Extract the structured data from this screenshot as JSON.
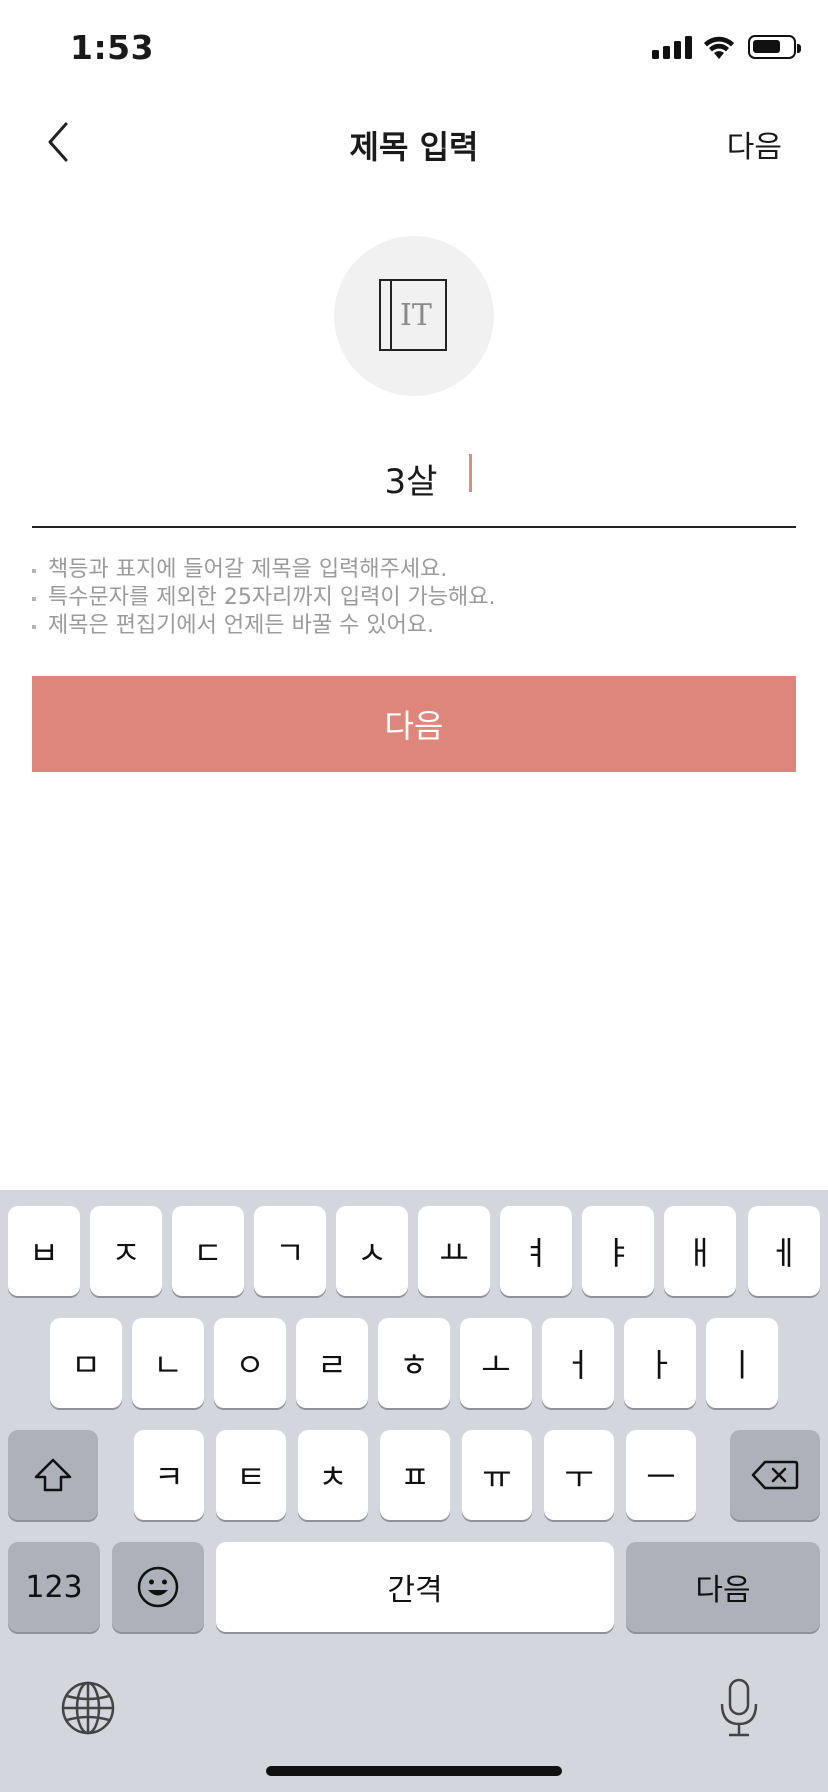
{
  "status_bar": {
    "time": "1:53"
  },
  "nav": {
    "title": "제목 입력",
    "next_label": "다음"
  },
  "book_icon": {
    "letters": "IT"
  },
  "title_input": {
    "value": "3살"
  },
  "hints": [
    "책등과 표지에 들어갈 제목을 입력해주세요.",
    "특수문자를 제외한 25자리까지 입력이 가능해요.",
    "제목은 편집기에서 언제든 바꿀 수 있어요."
  ],
  "primary_button": {
    "label": "다음"
  },
  "colors": {
    "accent": "#df867c",
    "keyboard_bg": "#d3d6dc",
    "key_dark": "#acb1ba"
  },
  "keyboard": {
    "row1": [
      "ㅂ",
      "ㅈ",
      "ㄷ",
      "ㄱ",
      "ㅅ",
      "ㅛ",
      "ㅕ",
      "ㅑ",
      "ㅐ",
      "ㅔ"
    ],
    "row2": [
      "ㅁ",
      "ㄴ",
      "ㅇ",
      "ㄹ",
      "ㅎ",
      "ㅗ",
      "ㅓ",
      "ㅏ",
      "ㅣ"
    ],
    "row3": [
      "ㅋ",
      "ㅌ",
      "ㅊ",
      "ㅍ",
      "ㅠ",
      "ㅜ",
      "ㅡ"
    ],
    "numbers_label": "123",
    "space_label": "간격",
    "return_label": "다음",
    "icons": [
      "shift-icon",
      "backspace-icon",
      "emoji-icon",
      "globe-icon",
      "microphone-icon"
    ]
  }
}
